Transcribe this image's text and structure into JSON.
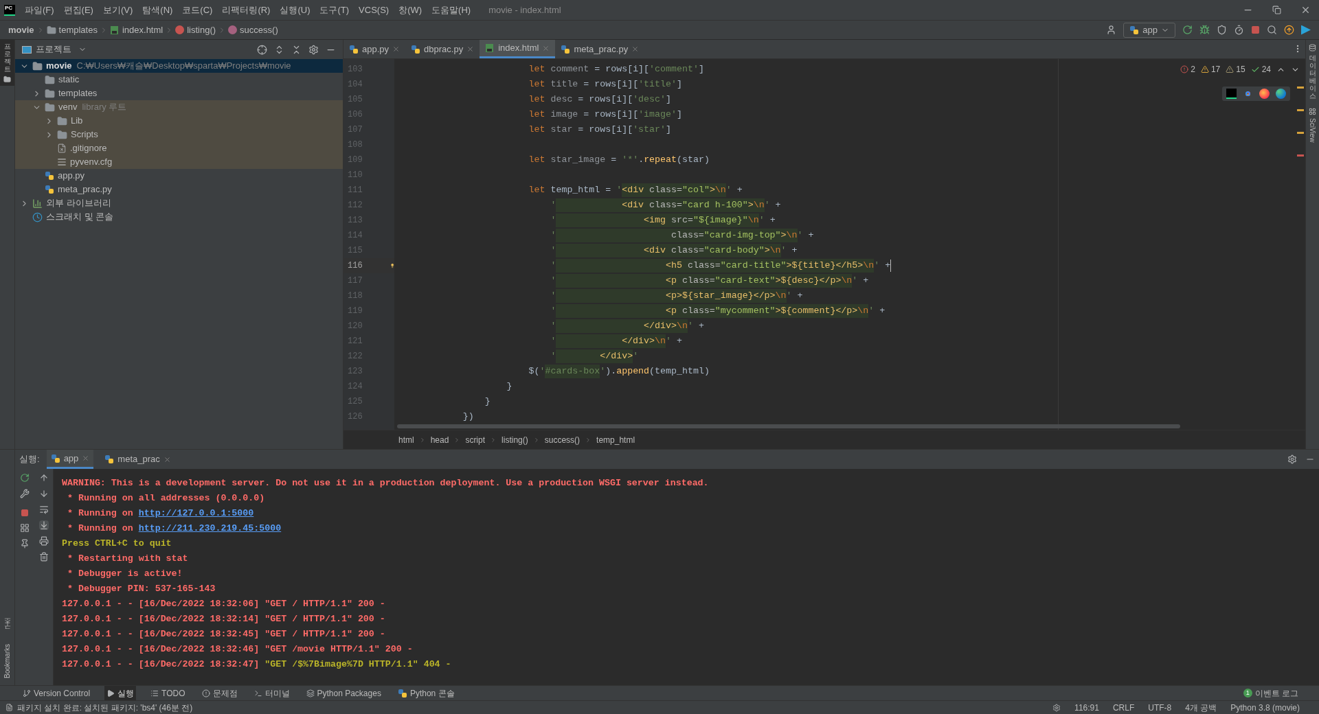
{
  "window": {
    "logo": "PC",
    "title": "movie - index.html"
  },
  "menu": [
    "파일(F)",
    "편집(E)",
    "보기(V)",
    "탐색(N)",
    "코드(C)",
    "리팩터링(R)",
    "실행(U)",
    "도구(T)",
    "VCS(S)",
    "창(W)",
    "도움말(H)"
  ],
  "nav": [
    {
      "label": "movie",
      "kind": "project"
    },
    {
      "label": "templates",
      "kind": "folder"
    },
    {
      "label": "index.html",
      "kind": "html"
    },
    {
      "label": "listing()",
      "kind": "function"
    },
    {
      "label": "success()",
      "kind": "method"
    }
  ],
  "run_config": "app",
  "left_strip": [
    {
      "label": "프로젝트",
      "selected": true
    },
    {
      "label": "구조",
      "selected": false
    },
    {
      "label": "Bookmarks",
      "selected": false
    }
  ],
  "right_strip": [
    "데이터베이스",
    "SciView"
  ],
  "project_panel": {
    "title": "프로젝트",
    "tree": [
      {
        "name": "movie",
        "hint": "C:₩Users₩캐슬₩Desktop₩sparta₩Projects₩movie",
        "kind": "folder",
        "expanded": true,
        "selected": true,
        "children": [
          {
            "name": "static",
            "kind": "folder",
            "selected": false
          },
          {
            "name": "templates",
            "kind": "folder",
            "expanded": false,
            "selected": false
          },
          {
            "name": "venv",
            "hint": "library 루트",
            "kind": "folder",
            "library_root": true,
            "expanded": true,
            "selected": false,
            "children": [
              {
                "name": "Lib",
                "kind": "folder",
                "expanded": false,
                "selected": false
              },
              {
                "name": "Scripts",
                "kind": "folder",
                "expanded": false,
                "selected": false
              },
              {
                "name": ".gitignore",
                "kind": "ignore",
                "selected": false
              },
              {
                "name": "pyvenv.cfg",
                "kind": "config",
                "selected": false
              }
            ]
          },
          {
            "name": "app.py",
            "kind": "python",
            "selected": false
          },
          {
            "name": "meta_prac.py",
            "kind": "python",
            "selected": false
          }
        ]
      },
      {
        "name": "외부 라이브러리",
        "kind": "library",
        "expanded": false,
        "selected": false
      },
      {
        "name": "스크래치 및 콘솔",
        "kind": "scratch",
        "selected": false
      }
    ]
  },
  "editor_tabs": [
    {
      "label": "app.py",
      "kind": "python",
      "selected": false
    },
    {
      "label": "dbprac.py",
      "kind": "python",
      "selected": false
    },
    {
      "label": "index.html",
      "kind": "html",
      "selected": true
    },
    {
      "label": "meta_prac.py",
      "kind": "python",
      "selected": false
    }
  ],
  "inspections": [
    {
      "kind": "error",
      "count": "2"
    },
    {
      "kind": "warning",
      "count": "17"
    },
    {
      "kind": "weak",
      "count": "15"
    },
    {
      "kind": "ok",
      "count": "24"
    }
  ],
  "code": [
    {
      "num": "103",
      "current": false,
      "segments": [
        {
          "text": "                        let ",
          "kind": "kw"
        },
        {
          "text": "comment",
          "kind": "var"
        },
        {
          "text": " = rows[i][",
          "kind": "pl"
        },
        {
          "text": "'comment'",
          "kind": "str"
        },
        {
          "text": "]",
          "kind": "pl"
        }
      ]
    },
    {
      "num": "104",
      "current": false,
      "segments": [
        {
          "text": "                        let ",
          "kind": "kw"
        },
        {
          "text": "title",
          "kind": "var"
        },
        {
          "text": " = rows[i][",
          "kind": "pl"
        },
        {
          "text": "'title'",
          "kind": "str"
        },
        {
          "text": "]",
          "kind": "pl"
        }
      ]
    },
    {
      "num": "105",
      "current": false,
      "segments": [
        {
          "text": "                        let ",
          "kind": "kw"
        },
        {
          "text": "desc",
          "kind": "var"
        },
        {
          "text": " = rows[i][",
          "kind": "pl"
        },
        {
          "text": "'desc'",
          "kind": "str"
        },
        {
          "text": "]",
          "kind": "pl"
        }
      ]
    },
    {
      "num": "106",
      "current": false,
      "segments": [
        {
          "text": "                        let ",
          "kind": "kw"
        },
        {
          "text": "image",
          "kind": "var"
        },
        {
          "text": " = rows[i][",
          "kind": "pl"
        },
        {
          "text": "'image'",
          "kind": "str"
        },
        {
          "text": "]",
          "kind": "pl"
        }
      ]
    },
    {
      "num": "107",
      "current": false,
      "segments": [
        {
          "text": "                        let ",
          "kind": "kw"
        },
        {
          "text": "star",
          "kind": "var"
        },
        {
          "text": " = rows[i][",
          "kind": "pl"
        },
        {
          "text": "'star'",
          "kind": "str"
        },
        {
          "text": "]",
          "kind": "pl"
        }
      ]
    },
    {
      "num": "108",
      "current": false
    },
    {
      "num": "109",
      "current": false,
      "segments": [
        {
          "text": "                        let ",
          "kind": "kw"
        },
        {
          "text": "star_image",
          "kind": "var"
        },
        {
          "text": " = ",
          "kind": "pl"
        },
        {
          "text": "'*'",
          "kind": "str"
        },
        {
          "text": ".",
          "kind": "pl"
        },
        {
          "text": "repeat",
          "kind": "fn"
        },
        {
          "text": "(star)",
          "kind": "pl"
        }
      ]
    },
    {
      "num": "110",
      "current": false
    },
    {
      "num": "111",
      "current": false,
      "segments": [
        {
          "text": "                        let ",
          "kind": "kw"
        },
        {
          "text": "temp_html = ",
          "kind": "pl"
        },
        {
          "text": "'",
          "kind": "str"
        },
        {
          "text": "<div",
          "kind": "tag"
        },
        {
          "text": " class=",
          "kind": "attr"
        },
        {
          "text": "\"col\"",
          "kind": "val"
        },
        {
          "text": ">",
          "kind": "tag"
        },
        {
          "text": "\\n",
          "kind": "esc"
        },
        {
          "text": "'",
          "kind": "str"
        },
        {
          "text": " +",
          "kind": "pl"
        }
      ]
    },
    {
      "num": "112",
      "current": false,
      "segments": [
        {
          "text": "                            '",
          "kind": "str"
        },
        {
          "text": "            <div",
          "kind": "tag"
        },
        {
          "text": " class=",
          "kind": "attr"
        },
        {
          "text": "\"card h-100\"",
          "kind": "val"
        },
        {
          "text": ">",
          "kind": "tag"
        },
        {
          "text": "\\n",
          "kind": "esc"
        },
        {
          "text": "'",
          "kind": "str"
        },
        {
          "text": " +",
          "kind": "pl"
        }
      ]
    },
    {
      "num": "113",
      "current": false,
      "segments": [
        {
          "text": "                            '",
          "kind": "str"
        },
        {
          "text": "                <img",
          "kind": "tag"
        },
        {
          "text": " src=",
          "kind": "attr"
        },
        {
          "text": "\"${image}\"",
          "kind": "val"
        },
        {
          "text": "\\n",
          "kind": "esc"
        },
        {
          "text": "'",
          "kind": "str"
        },
        {
          "text": " +",
          "kind": "pl"
        }
      ]
    },
    {
      "num": "114",
      "current": false,
      "segments": [
        {
          "text": "                            '",
          "kind": "str"
        },
        {
          "text": "                     class=",
          "kind": "attr"
        },
        {
          "text": "\"card-img-top\"",
          "kind": "val"
        },
        {
          "text": ">",
          "kind": "tag"
        },
        {
          "text": "\\n",
          "kind": "esc"
        },
        {
          "text": "'",
          "kind": "str"
        },
        {
          "text": " +",
          "kind": "pl"
        }
      ]
    },
    {
      "num": "115",
      "current": false,
      "segments": [
        {
          "text": "                            '",
          "kind": "str"
        },
        {
          "text": "                <div",
          "kind": "tag"
        },
        {
          "text": " class=",
          "kind": "attr"
        },
        {
          "text": "\"card-body\"",
          "kind": "val"
        },
        {
          "text": ">",
          "kind": "tag"
        },
        {
          "text": "\\n",
          "kind": "esc"
        },
        {
          "text": "'",
          "kind": "str"
        },
        {
          "text": " +",
          "kind": "pl"
        }
      ]
    },
    {
      "num": "116",
      "current": true,
      "segments": [
        {
          "text": "                            '",
          "kind": "str"
        },
        {
          "text": "                    <h5",
          "kind": "tag"
        },
        {
          "text": " class=",
          "kind": "attr"
        },
        {
          "text": "\"card-title\"",
          "kind": "val"
        },
        {
          "text": ">${title}</h5>",
          "kind": "tag"
        },
        {
          "text": "\\n",
          "kind": "esc"
        },
        {
          "text": "'",
          "kind": "str"
        },
        {
          "text": " +",
          "kind": "pl"
        }
      ]
    },
    {
      "num": "117",
      "current": false,
      "segments": [
        {
          "text": "                            '",
          "kind": "str"
        },
        {
          "text": "                    <p",
          "kind": "tag"
        },
        {
          "text": " class=",
          "kind": "attr"
        },
        {
          "text": "\"card-text\"",
          "kind": "val"
        },
        {
          "text": ">${desc}</p>",
          "kind": "tag"
        },
        {
          "text": "\\n",
          "kind": "esc"
        },
        {
          "text": "'",
          "kind": "str"
        },
        {
          "text": " +",
          "kind": "pl"
        }
      ]
    },
    {
      "num": "118",
      "current": false,
      "segments": [
        {
          "text": "                            '",
          "kind": "str"
        },
        {
          "text": "                    <p>${star_image}</p>",
          "kind": "tag"
        },
        {
          "text": "\\n",
          "kind": "esc"
        },
        {
          "text": "'",
          "kind": "str"
        },
        {
          "text": " +",
          "kind": "pl"
        }
      ]
    },
    {
      "num": "119",
      "current": false,
      "segments": [
        {
          "text": "                            '",
          "kind": "str"
        },
        {
          "text": "                    <p",
          "kind": "tag"
        },
        {
          "text": " class=",
          "kind": "attr"
        },
        {
          "text": "\"mycomment\"",
          "kind": "val"
        },
        {
          "text": ">${comment}</p>",
          "kind": "tag"
        },
        {
          "text": "\\n",
          "kind": "esc"
        },
        {
          "text": "'",
          "kind": "str"
        },
        {
          "text": " +",
          "kind": "pl"
        }
      ]
    },
    {
      "num": "120",
      "current": false,
      "segments": [
        {
          "text": "                            '",
          "kind": "str"
        },
        {
          "text": "                </div>",
          "kind": "tag"
        },
        {
          "text": "\\n",
          "kind": "esc"
        },
        {
          "text": "'",
          "kind": "str"
        },
        {
          "text": " +",
          "kind": "pl"
        }
      ]
    },
    {
      "num": "121",
      "current": false,
      "segments": [
        {
          "text": "                            '",
          "kind": "str"
        },
        {
          "text": "            </div>",
          "kind": "tag"
        },
        {
          "text": "\\n",
          "kind": "esc"
        },
        {
          "text": "'",
          "kind": "str"
        },
        {
          "text": " +",
          "kind": "pl"
        }
      ]
    },
    {
      "num": "122",
      "current": false,
      "segments": [
        {
          "text": "                            '",
          "kind": "str"
        },
        {
          "text": "        </div>",
          "kind": "tag"
        },
        {
          "text": "'",
          "kind": "str"
        }
      ]
    },
    {
      "num": "123",
      "current": false,
      "segments": [
        {
          "text": "                        $(",
          "kind": "pl"
        },
        {
          "text": "'",
          "kind": "str"
        },
        {
          "text": "#cards-box",
          "kind": "frag"
        },
        {
          "text": "'",
          "kind": "str"
        },
        {
          "text": ").",
          "kind": "pl"
        },
        {
          "text": "append",
          "kind": "fn"
        },
        {
          "text": "(temp_html)",
          "kind": "pl"
        }
      ]
    },
    {
      "num": "124",
      "current": false,
      "segments": [
        {
          "text": "                    }",
          "kind": "pl"
        }
      ]
    },
    {
      "num": "125",
      "current": false,
      "segments": [
        {
          "text": "                }",
          "kind": "pl"
        }
      ]
    },
    {
      "num": "126",
      "current": false,
      "segments": [
        {
          "text": "            })",
          "kind": "pl"
        }
      ]
    }
  ],
  "editor_breadcrumbs": [
    "html",
    "head",
    "script",
    "listing()",
    "success()",
    "temp_html"
  ],
  "run_panel": {
    "label": "실행:",
    "tabs": [
      {
        "label": "app",
        "selected": true
      },
      {
        "label": "meta_prac",
        "selected": false
      }
    ],
    "lines": [
      {
        "segments": [
          {
            "text": "WARNING: This is a development server. Do not use it in a production deployment. Use a production WSGI server instead.",
            "kind": "warn"
          }
        ]
      },
      {
        "segments": [
          {
            "text": " * Running on all addresses (0.0.0.0)",
            "kind": "err"
          }
        ]
      },
      {
        "segments": [
          {
            "text": " * Running on ",
            "kind": "err"
          },
          {
            "text": "http://127.0.0.1:5000",
            "kind": "link"
          }
        ]
      },
      {
        "segments": [
          {
            "text": " * Running on ",
            "kind": "err"
          },
          {
            "text": "http://211.230.219.45:5000",
            "kind": "link"
          }
        ]
      },
      {
        "segments": [
          {
            "text": "Press CTRL+C to quit",
            "kind": "note"
          }
        ]
      },
      {
        "segments": [
          {
            "text": " * Restarting with stat",
            "kind": "err"
          }
        ]
      },
      {
        "segments": [
          {
            "text": " * Debugger is active!",
            "kind": "err"
          }
        ]
      },
      {
        "segments": [
          {
            "text": " * Debugger PIN: 537-165-143",
            "kind": "err"
          }
        ]
      },
      {
        "segments": [
          {
            "text": "127.0.0.1 - - [16/Dec/2022 18:32:06] \"GET / HTTP/1.1\" 200 -",
            "kind": "err"
          }
        ]
      },
      {
        "segments": [
          {
            "text": "127.0.0.1 - - [16/Dec/2022 18:32:14] \"GET / HTTP/1.1\" 200 -",
            "kind": "err"
          }
        ]
      },
      {
        "segments": [
          {
            "text": "127.0.0.1 - - [16/Dec/2022 18:32:45] \"GET / HTTP/1.1\" 200 -",
            "kind": "err"
          }
        ]
      },
      {
        "segments": [
          {
            "text": "127.0.0.1 - - [16/Dec/2022 18:32:46] \"GET /movie HTTP/1.1\" 200 -",
            "kind": "err"
          }
        ]
      },
      {
        "segments": [
          {
            "text": "127.0.0.1 - - [16/Dec/2022 18:32:47] ",
            "kind": "err"
          },
          {
            "text": "\"GET /$%7Bimage%7D HTTP/1.1\" 404 -",
            "kind": "note"
          }
        ]
      }
    ]
  },
  "tool_windows": [
    {
      "label": "Version Control",
      "kind": "vcs",
      "selected": false
    },
    {
      "label": "실행",
      "kind": "run",
      "selected": true
    },
    {
      "label": "TODO",
      "kind": "todo",
      "selected": false
    },
    {
      "label": "문제점",
      "kind": "problems",
      "selected": false
    },
    {
      "label": "터미널",
      "kind": "terminal",
      "selected": false
    },
    {
      "label": "Python Packages",
      "kind": "packages",
      "selected": false
    },
    {
      "label": "Python 콘솔",
      "kind": "console",
      "selected": false
    }
  ],
  "event_log": {
    "badge": "1",
    "label": "이벤트 로그"
  },
  "status_bar": {
    "message": "패키지 설치 완료: 설치된 패키지: 'bs4' (46분 전)",
    "items": [
      "116:91",
      "CRLF",
      "UTF-8",
      "4개 공백",
      "Python 3.8 (movie)"
    ]
  }
}
